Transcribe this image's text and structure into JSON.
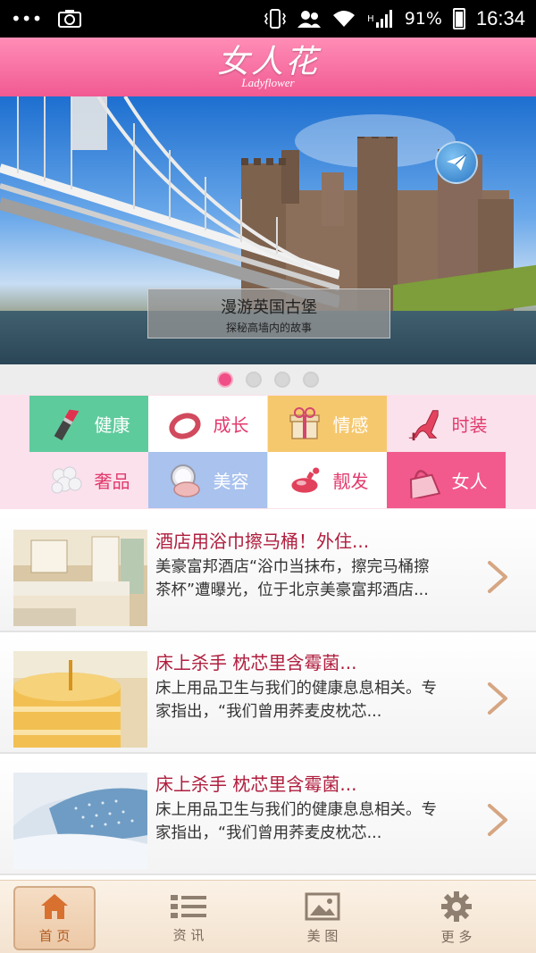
{
  "status_bar": {
    "left_dots": "•••",
    "battery_percent": "91%",
    "time": "16:34",
    "network": "H"
  },
  "header": {
    "logo_main": "女人花",
    "logo_sub": "Ladyflower"
  },
  "banner": {
    "caption_title": "漫游英国古堡",
    "caption_subtitle": "探秘高墙内的故事",
    "page_indicator": {
      "count": 4,
      "active_index": 0
    }
  },
  "categories": [
    {
      "label": "健康",
      "icon": "lipstick-icon",
      "bg": "#5ecb9c",
      "text_color": "#ffffff"
    },
    {
      "label": "成长",
      "icon": "bracelet-icon",
      "bg": "#ffffff",
      "text_color": "#e23a6d"
    },
    {
      "label": "情感",
      "icon": "gift-box-icon",
      "bg": "#f6c86e",
      "text_color": "#ffffff"
    },
    {
      "label": "时装",
      "icon": "high-heel-icon",
      "bg": "#fbe1ec",
      "text_color": "#e23a6d"
    },
    {
      "label": "奢品",
      "icon": "pearls-icon",
      "bg": "#fbe1ec",
      "text_color": "#e23a6d"
    },
    {
      "label": "美容",
      "icon": "compact-mirror-icon",
      "bg": "#a9c2ee",
      "text_color": "#ffffff"
    },
    {
      "label": "靓发",
      "icon": "perfume-icon",
      "bg": "#ffffff",
      "text_color": "#e23a6d"
    },
    {
      "label": "女人",
      "icon": "handbag-icon",
      "bg": "#f25a8d",
      "text_color": "#ffffff"
    }
  ],
  "news": [
    {
      "title": "酒店用浴巾擦马桶！外住...",
      "body": "美豪富邦酒店“浴巾当抹布，擦完马桶擦茶杯”遭曝光，位于北京美豪富邦酒店...",
      "thumb": "hotel-room"
    },
    {
      "title": "床上杀手 枕芯里含霉菌...",
      "body": "床上用品卫生与我们的健康息息相关。专家指出，“我们曾用荞麦皮枕芯...",
      "thumb": "honey-jar"
    },
    {
      "title": "床上杀手 枕芯里含霉菌...",
      "body": "床上用品卫生与我们的健康息息相关。专家指出，“我们曾用荞麦皮枕芯...",
      "thumb": "pillow"
    }
  ],
  "bottom_nav": [
    {
      "label": "首 页",
      "icon": "home-icon",
      "active": true
    },
    {
      "label": "资 讯",
      "icon": "list-icon",
      "active": false
    },
    {
      "label": "美 图",
      "icon": "picture-icon",
      "active": false
    },
    {
      "label": "更 多",
      "icon": "gear-icon",
      "active": false
    }
  ],
  "colors": {
    "brand_pink": "#f15a92",
    "title_red": "#b01e3e",
    "nav_active": "#b35a1f"
  }
}
